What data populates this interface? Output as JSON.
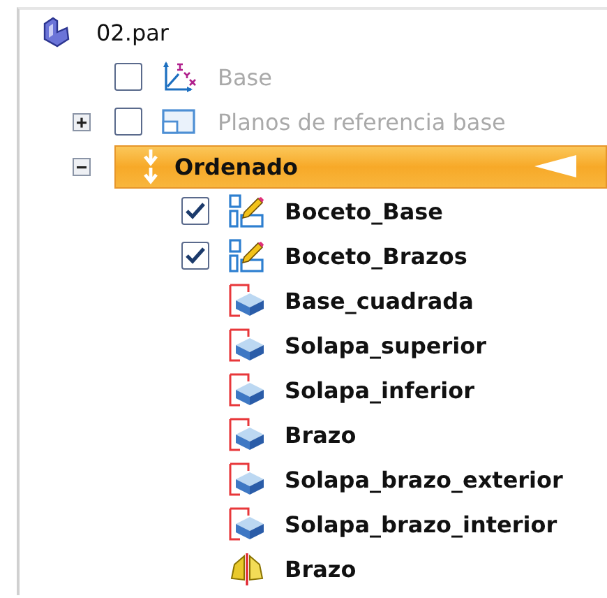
{
  "tree": {
    "label": "02.par",
    "kind": "part",
    "selected": false,
    "children": [
      {
        "label": "Base",
        "kind": "coord",
        "checked": false,
        "disabled": true,
        "selected": false
      },
      {
        "label": "Planos de referencia base",
        "kind": "planes",
        "checked": false,
        "disabled": true,
        "expanded": false,
        "selected": false
      },
      {
        "label": "Ordenado",
        "kind": "group",
        "disabled": false,
        "expanded": true,
        "selected": true,
        "children": [
          {
            "label": "Boceto_Base",
            "kind": "sketch",
            "checked": true,
            "selected": false
          },
          {
            "label": "Boceto_Brazos",
            "kind": "sketch",
            "checked": true,
            "selected": false
          },
          {
            "label": "Base_cuadrada",
            "kind": "feature",
            "selected": false
          },
          {
            "label": "Solapa_superior",
            "kind": "feature",
            "selected": false
          },
          {
            "label": "Solapa_inferior",
            "kind": "feature",
            "selected": false
          },
          {
            "label": "Brazo",
            "kind": "feature",
            "selected": false
          },
          {
            "label": "Solapa_brazo_exterior",
            "kind": "feature",
            "selected": false
          },
          {
            "label": "Solapa_brazo_interior",
            "kind": "feature",
            "selected": false
          },
          {
            "label": "Brazo",
            "kind": "mirror",
            "selected": false
          }
        ]
      }
    ]
  }
}
